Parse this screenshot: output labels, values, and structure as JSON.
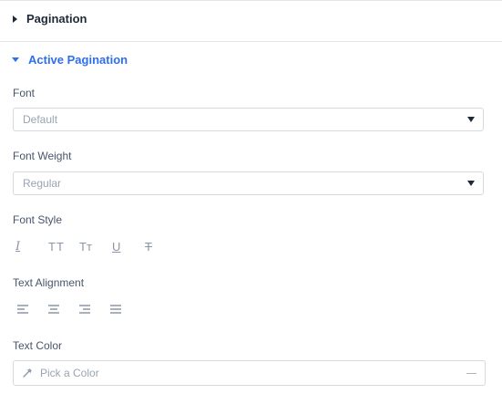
{
  "sections": {
    "pagination": {
      "label": "Pagination"
    },
    "active_pagination": {
      "label": "Active Pagination"
    }
  },
  "font": {
    "label": "Font",
    "value": "Default"
  },
  "font_weight": {
    "label": "Font Weight",
    "value": "Regular"
  },
  "font_style": {
    "label": "Font Style",
    "buttons": [
      {
        "name": "italic",
        "glyph": "I"
      },
      {
        "name": "uppercase",
        "glyph": "TT"
      },
      {
        "name": "small-caps",
        "glyph": "Tт"
      },
      {
        "name": "underline",
        "glyph": "U"
      },
      {
        "name": "strikethrough",
        "glyph": "T"
      }
    ]
  },
  "text_alignment": {
    "label": "Text Alignment",
    "options": [
      "left",
      "center",
      "right",
      "justify"
    ]
  },
  "text_color": {
    "label": "Text Color",
    "placeholder": "Pick a Color"
  },
  "colors": {
    "accent": "#2f6fed",
    "text": "#2c3a4b",
    "muted": "#9aa4b2",
    "border": "#d5d9e0"
  }
}
